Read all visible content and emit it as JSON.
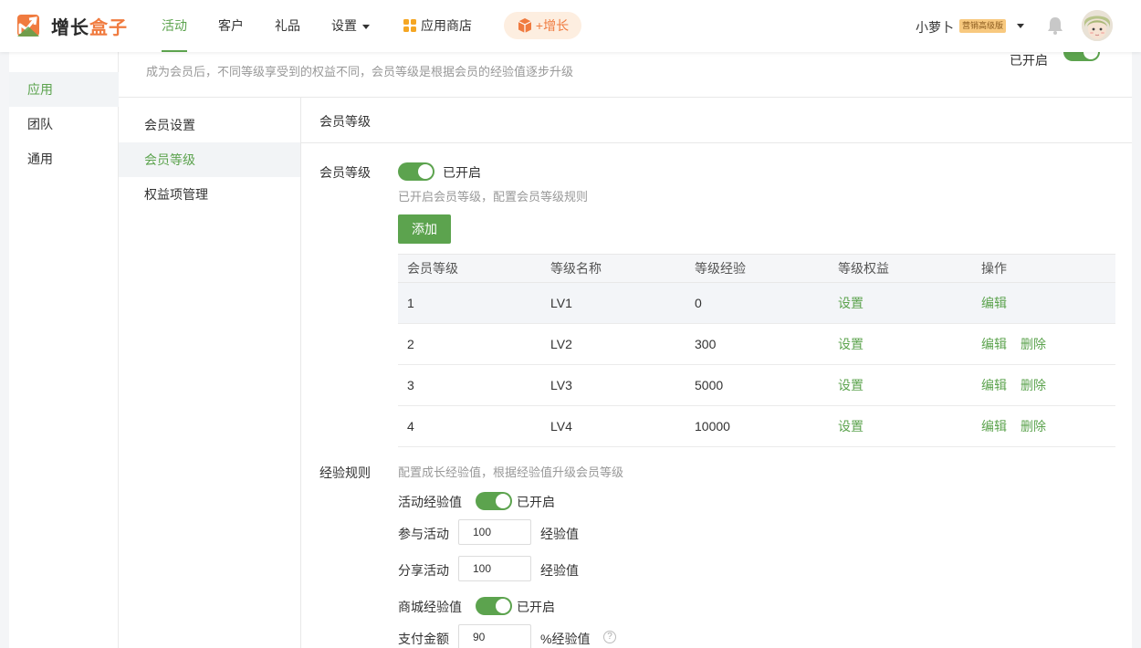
{
  "brand": {
    "name_part1": "增长",
    "name_part2": "盒子",
    "accent": "#5ca34e",
    "orange": "#f07b3f"
  },
  "nav": {
    "items": [
      "活动",
      "客户",
      "礼品",
      "设置",
      "应用商店"
    ],
    "grow_label": "+增长"
  },
  "user": {
    "name": "小萝卜",
    "badge": "营销高级版"
  },
  "sidebar": {
    "items": [
      "应用",
      "团队",
      "通用"
    ]
  },
  "panel": {
    "description": "成为会员后，不同等级享受到的权益不同，会员等级是根据会员的经验值逐步升级",
    "top_toggle_label": "已开启"
  },
  "sub_nav": {
    "items": [
      "会员设置",
      "会员等级",
      "权益项管理"
    ]
  },
  "section": {
    "title": "会员等级"
  },
  "level_setting": {
    "label": "会员等级",
    "switch_text": "已开启",
    "hint": "已开启会员等级，配置会员等级规则",
    "add_button": "添加"
  },
  "table": {
    "headers": [
      "会员等级",
      "等级名称",
      "等级经验",
      "等级权益",
      "操作"
    ],
    "rows": [
      {
        "level": "1",
        "name": "LV1",
        "exp": "0",
        "benefit": "设置",
        "edit": "编辑",
        "delete": ""
      },
      {
        "level": "2",
        "name": "LV2",
        "exp": "300",
        "benefit": "设置",
        "edit": "编辑",
        "delete": "删除"
      },
      {
        "level": "3",
        "name": "LV3",
        "exp": "5000",
        "benefit": "设置",
        "edit": "编辑",
        "delete": "删除"
      },
      {
        "level": "4",
        "name": "LV4",
        "exp": "10000",
        "benefit": "设置",
        "edit": "编辑",
        "delete": "删除"
      }
    ]
  },
  "exp_rules": {
    "label": "经验规则",
    "hint": "配置成长经验值，根据经验值升级会员等级",
    "activity_label": "活动经验值",
    "activity_switch_text": "已开启",
    "join_label": "参与活动",
    "join_value": "100",
    "join_unit": "经验值",
    "share_label": "分享活动",
    "share_value": "100",
    "share_unit": "经验值",
    "mall_label": "商城经验值",
    "mall_switch_text": "已开启",
    "pay_label": "支付金额",
    "pay_value": "90",
    "pay_unit": "%经验值",
    "help_glyph": "?"
  }
}
